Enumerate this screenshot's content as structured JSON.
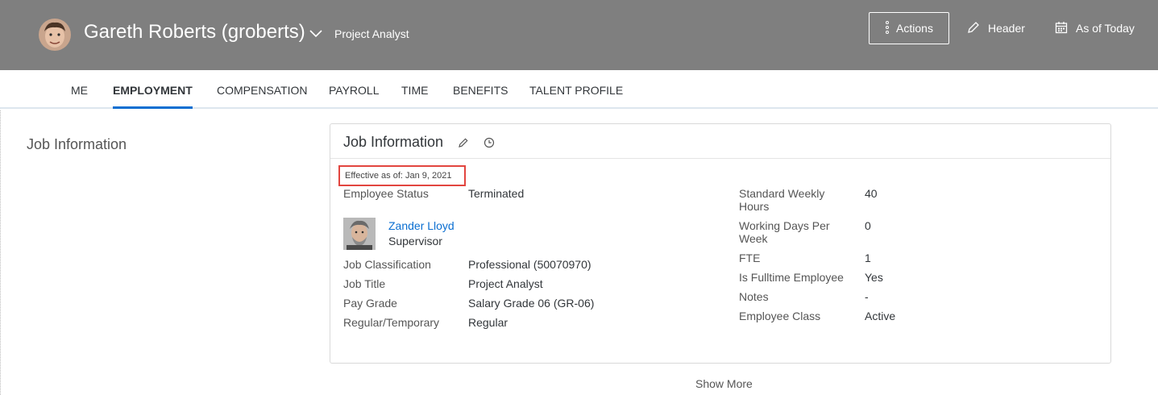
{
  "header": {
    "user_name": "Gareth Roberts (groberts)",
    "job_title": "Project Analyst",
    "actions_label": "Actions",
    "header_label": "Header",
    "as_of_label": "As of Today"
  },
  "tabs": [
    {
      "label": "ME",
      "active": false
    },
    {
      "label": "EMPLOYMENT",
      "active": true
    },
    {
      "label": "COMPENSATION",
      "active": false
    },
    {
      "label": "PAYROLL",
      "active": false
    },
    {
      "label": "TIME",
      "active": false
    },
    {
      "label": "BENEFITS",
      "active": false
    },
    {
      "label": "TALENT PROFILE",
      "active": false
    }
  ],
  "section": {
    "label": "Job Information"
  },
  "card": {
    "title": "Job Information",
    "effective": "Effective as of: Jan 9, 2021",
    "left_fields": [
      {
        "label": "Employee Status",
        "value": "Terminated"
      },
      {
        "label": "Job Classification",
        "value": "Professional (50070970)"
      },
      {
        "label": "Job Title",
        "value": "Project Analyst"
      },
      {
        "label": "Pay Grade",
        "value": "Salary Grade 06 (GR-06)"
      },
      {
        "label": "Regular/Temporary",
        "value": "Regular"
      }
    ],
    "supervisor": {
      "name": "Zander Lloyd",
      "role": "Supervisor"
    },
    "right_fields": [
      {
        "label": "Standard Weekly Hours",
        "value": "40"
      },
      {
        "label": "Working Days Per Week",
        "value": "0"
      },
      {
        "label": "FTE",
        "value": "1"
      },
      {
        "label": "Is Fulltime Employee",
        "value": "Yes"
      },
      {
        "label": "Notes",
        "value": "-"
      },
      {
        "label": "Employee Class",
        "value": "Active"
      }
    ]
  },
  "show_more_label": "Show More",
  "colors": {
    "header_bg": "#7f7f7f",
    "link": "#0a6ed1",
    "highlight": "#e2453f"
  }
}
